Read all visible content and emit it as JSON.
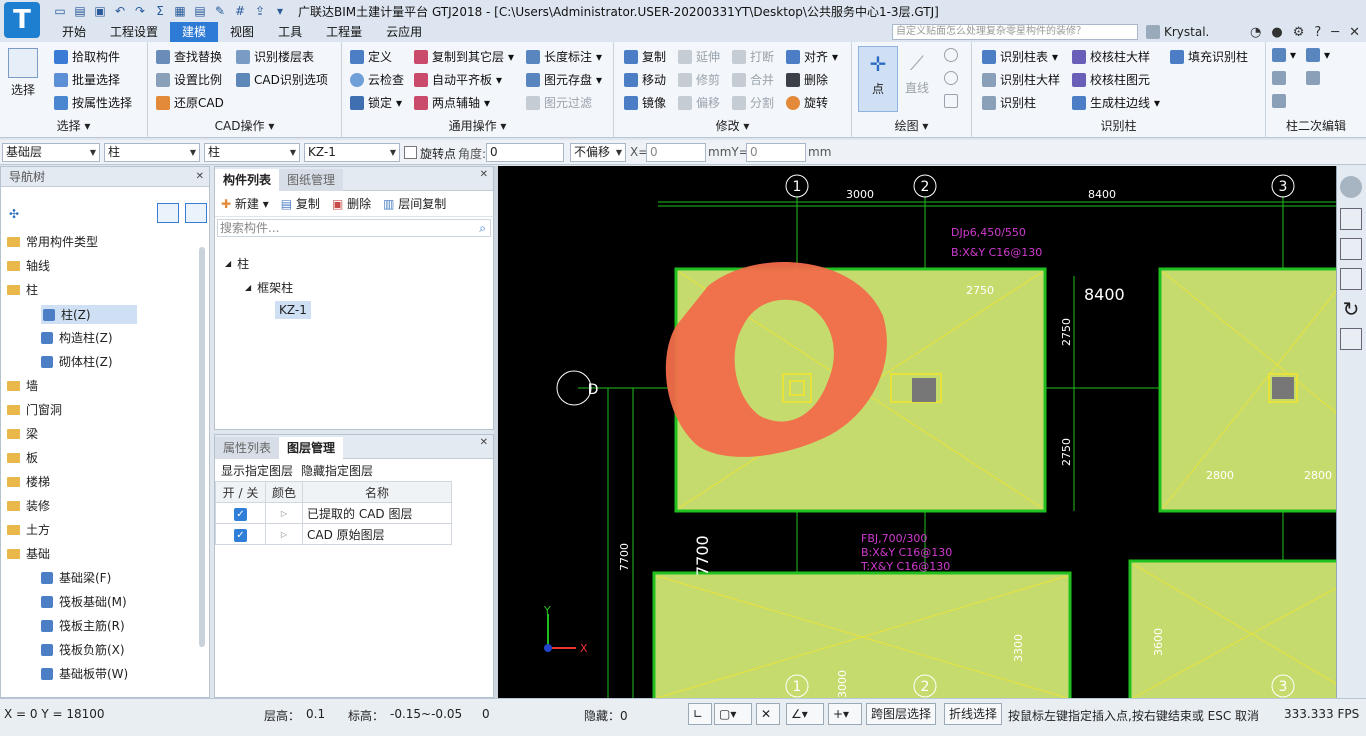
{
  "app": {
    "title": "广联达BIM土建计量平台 GTJ2018 - [C:\\Users\\Administrator.USER-20200331YT\\Desktop\\公共服务中心1-3层.GTJ]",
    "logo": "T",
    "user": "Krystal."
  },
  "menu": {
    "tabs": [
      "开始",
      "工程设置",
      "建模",
      "视图",
      "工具",
      "工程量",
      "云应用"
    ],
    "active": "建模",
    "search_placeholder": "自定义贴面怎么处理复杂零星构件的装修？"
  },
  "ribbon": {
    "select": {
      "big": "选择",
      "items": [
        "拾取构件",
        "批量选择",
        "按属性选择"
      ],
      "label": "选择"
    },
    "cad": {
      "items": [
        "查找替换",
        "识别楼层表",
        "设置比例",
        "CAD识别选项",
        "还原CAD"
      ],
      "label": "CAD操作"
    },
    "common": {
      "items": [
        "定义",
        "复制到其它层",
        "长度标注",
        "云检查",
        "自动平齐板",
        "图元存盘",
        "锁定",
        "两点辅轴",
        "图元过滤"
      ],
      "label": "通用操作"
    },
    "modify": {
      "items": [
        "复制",
        "延伸",
        "打断",
        "对齐",
        "移动",
        "修剪",
        "合并",
        "删除",
        "镜像",
        "偏移",
        "分割",
        "旋转"
      ],
      "label": "修改"
    },
    "draw": {
      "items": [
        "点",
        "直线"
      ],
      "label": "绘图"
    },
    "recog": {
      "items": [
        "识别柱表",
        "校核柱大样",
        "填充识别柱",
        "识别柱大样",
        "校核柱图元",
        "识别柱",
        "生成柱边线"
      ],
      "label": "识别柱"
    },
    "col2": {
      "label": "柱二次编辑"
    }
  },
  "propbar": {
    "floor": "基础层",
    "type": "柱",
    "subtype": "柱",
    "component": "KZ-1",
    "rotate_label": "旋转点",
    "angle_label": "角度:",
    "angle_value": "0",
    "offset": "不偏移",
    "x_label": "X=",
    "x_value": "0",
    "mm_y": "mmY=",
    "y_value": "0",
    "mm": "mm"
  },
  "nav": {
    "title": "导航树",
    "items": [
      {
        "label": "常用构件类型",
        "level": 0
      },
      {
        "label": "轴线",
        "level": 0
      },
      {
        "label": "柱",
        "level": 0
      },
      {
        "label": "柱(Z)",
        "level": 1,
        "selected": true
      },
      {
        "label": "构造柱(Z)",
        "level": 1
      },
      {
        "label": "砌体柱(Z)",
        "level": 1
      },
      {
        "label": "墙",
        "level": 0
      },
      {
        "label": "门窗洞",
        "level": 0
      },
      {
        "label": "梁",
        "level": 0
      },
      {
        "label": "板",
        "level": 0
      },
      {
        "label": "楼梯",
        "level": 0
      },
      {
        "label": "装修",
        "level": 0
      },
      {
        "label": "土方",
        "level": 0
      },
      {
        "label": "基础",
        "level": 0
      },
      {
        "label": "基础梁(F)",
        "level": 1
      },
      {
        "label": "筏板基础(M)",
        "level": 1
      },
      {
        "label": "筏板主筋(R)",
        "level": 1
      },
      {
        "label": "筏板负筋(X)",
        "level": 1
      },
      {
        "label": "基础板带(W)",
        "level": 1
      }
    ]
  },
  "components": {
    "tabs": [
      "构件列表",
      "图纸管理"
    ],
    "actions": [
      "新建",
      "复制",
      "删除",
      "层间复制"
    ],
    "search_placeholder": "搜索构件...",
    "tree": [
      "柱",
      "框架柱",
      "KZ-1"
    ]
  },
  "layers": {
    "tabs": [
      "属性列表",
      "图层管理"
    ],
    "actions": [
      "显示指定图层",
      "隐藏指定图层"
    ],
    "headers": [
      "开 / 关",
      "颜色",
      "名称"
    ],
    "rows": [
      "已提取的 CAD 图层",
      "CAD 原始图层"
    ]
  },
  "drawing": {
    "axes_top": [
      "1",
      "2",
      "3"
    ],
    "dims_top": [
      "3000",
      "8400"
    ],
    "axis_left": "D",
    "big_dim": "8400",
    "labels_pink_1": [
      "DJp6,450/550",
      "B:X&Y C16@130"
    ],
    "labels_pink_2": [
      "FBJ,700/300",
      "B:X&Y C16@130",
      "T:X&Y C16@130"
    ],
    "dims_side": [
      "2750",
      "2750",
      "7700",
      "7700",
      "2800",
      "2800",
      "3300",
      "3600",
      "3000",
      "2750"
    ],
    "axis_x": "X",
    "axis_y": "Y"
  },
  "status": {
    "coords": "X = 0 Y = 18100",
    "floor_h_label": "层高：",
    "floor_h": "0.1",
    "elev_label": "标高：",
    "elev": "-0.15~-0.05",
    "zero": "0",
    "hidden": "隐藏：0",
    "cross_layer": "跨图层选择",
    "polyline": "折线选择",
    "hint": "按鼠标左键指定插入点,按右键结束或 ESC 取消",
    "fps": "333.333 FPS"
  }
}
